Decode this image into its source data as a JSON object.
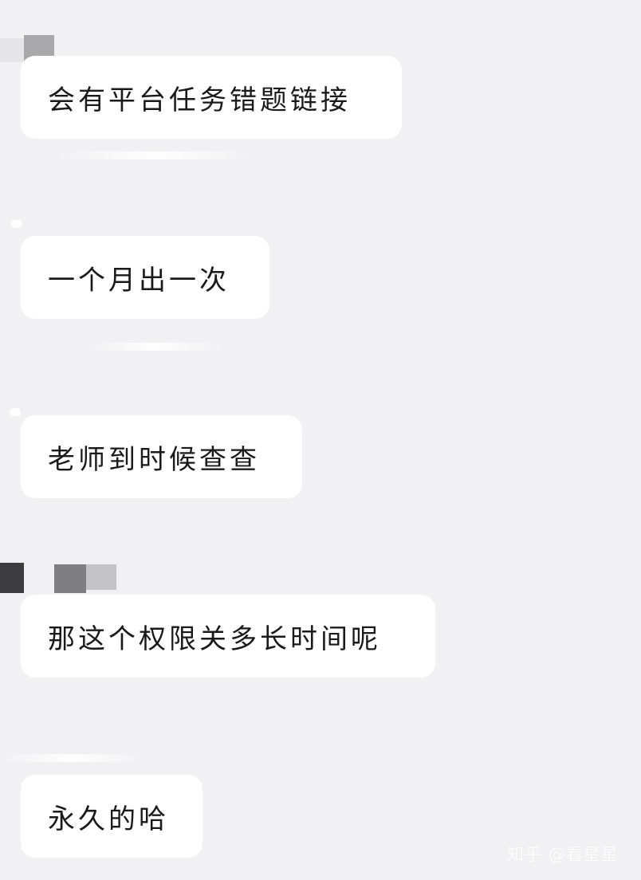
{
  "chat": {
    "messages": [
      {
        "text": "会有平台任务错题链接"
      },
      {
        "text": "一个月出一次"
      },
      {
        "text": "老师到时候查查"
      },
      {
        "text": "那这个权限关多长时间呢"
      },
      {
        "text": "永久的哈"
      }
    ]
  },
  "watermark": {
    "text": "知乎 @看星星"
  },
  "colors": {
    "background": "#f1f1f3",
    "bubble": "#ffffff",
    "text": "#1a1a1a"
  }
}
